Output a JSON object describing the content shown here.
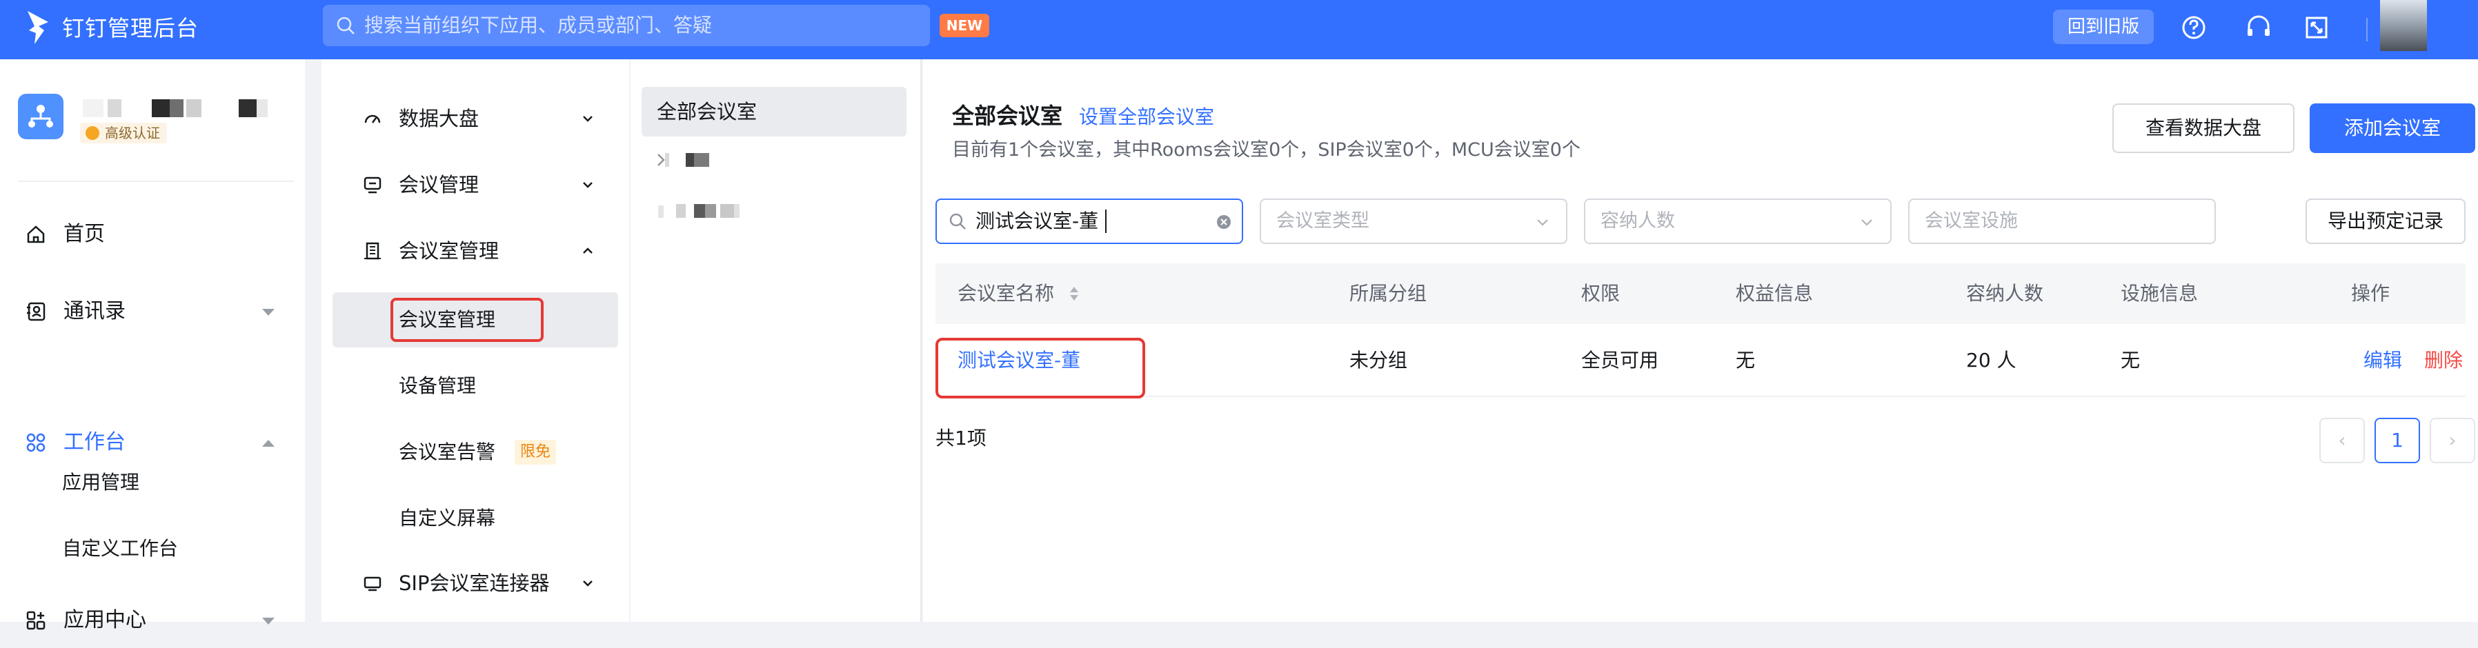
{
  "app": {
    "title": "钉钉管理后台",
    "search_placeholder": "搜索当前组织下应用、成员或部门、答疑",
    "new_badge": "NEW",
    "back_old_label": "回到旧版"
  },
  "org": {
    "cert_label": "高级认证"
  },
  "leftnav": {
    "items": [
      {
        "label": "首页",
        "icon": "home-icon"
      },
      {
        "label": "通讯录",
        "icon": "contacts-icon"
      },
      {
        "label": "工作台",
        "icon": "workbench-icon"
      },
      {
        "label": "应用管理"
      },
      {
        "label": "自定义工作台"
      },
      {
        "label": "应用中心",
        "icon": "app-center-icon"
      }
    ]
  },
  "menu2": {
    "data_dashboard": "数据大盘",
    "meeting_mgmt": "会议管理",
    "room_mgmt": "会议室管理",
    "room_mgmt_sub": "会议室管理",
    "device_mgmt": "设备管理",
    "room_alert": "会议室告警",
    "limit_free": "限免",
    "custom_screen": "自定义屏幕",
    "sip_connector": "SIP会议室连接器"
  },
  "tree": {
    "all_label": "全部会议室"
  },
  "main": {
    "title": "全部会议室",
    "set_all_link": "设置全部会议室",
    "summary": "目前有1个会议室，其中Rooms会议室0个，SIP会议室0个，MCU会议室0个",
    "btn_dashboard": "查看数据大盘",
    "btn_add": "添加会议室",
    "filters": {
      "name_value": "测试会议室-董",
      "type_placeholder": "会议室类型",
      "capacity_placeholder": "容纳人数",
      "facility_placeholder": "会议室设施"
    },
    "btn_export": "导出预定记录",
    "table": {
      "headers": [
        "会议室名称",
        "所属分组",
        "权限",
        "权益信息",
        "容纳人数",
        "设施信息",
        "操作"
      ],
      "rows": [
        {
          "name": "测试会议室-董",
          "group": "未分组",
          "permission": "全员可用",
          "benefit": "无",
          "capacity": "20 人",
          "facility": "无",
          "edit": "编辑",
          "delete": "删除"
        }
      ]
    },
    "total": "共1项",
    "pagination": {
      "prev": "‹",
      "current": "1",
      "next": "›"
    }
  },
  "colors": {
    "brand": "#3370ff",
    "danger": "#f54a45",
    "highlight_box": "#e53935"
  }
}
